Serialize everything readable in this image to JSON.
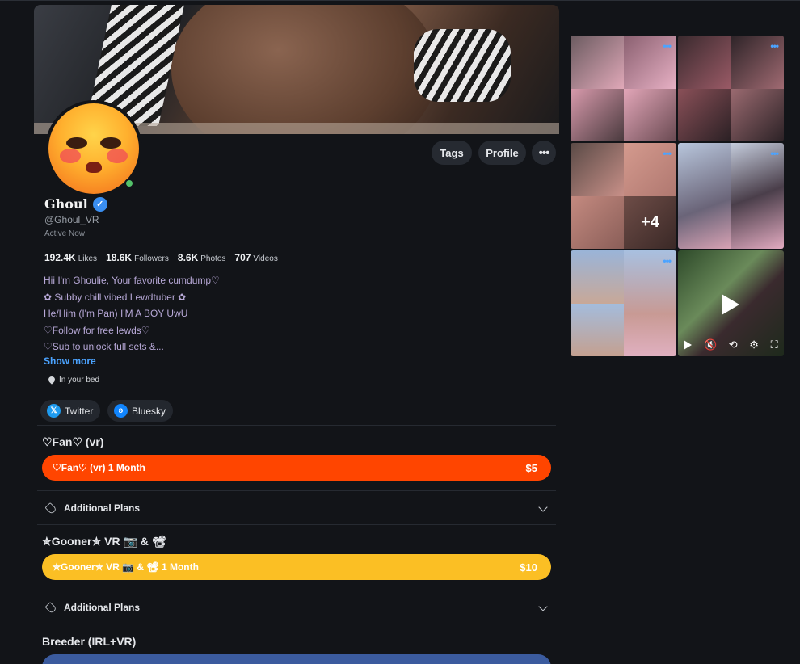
{
  "header": {
    "tags_label": "Tags",
    "profile_label": "Profile",
    "more_label": "•••"
  },
  "profile": {
    "name": "Ghoul",
    "handle": "@Ghoul_VR",
    "status": "Active Now",
    "stats": [
      {
        "value": "192.4K",
        "label": "Likes"
      },
      {
        "value": "18.6K",
        "label": "Followers"
      },
      {
        "value": "8.6K",
        "label": "Photos"
      },
      {
        "value": "707",
        "label": "Videos"
      }
    ],
    "bio": [
      "Hii I'm Ghoulie, Your favorite cumdump♡",
      "✿ Subby chill vibed Lewdtuber ✿",
      "He/Him (I'm Pan) I'M A BOY UwU",
      "♡Follow for free lewds♡",
      "♡Sub to unlock full sets &..."
    ],
    "show_more": "Show more",
    "location": "In your bed",
    "socials": [
      {
        "name": "Twitter",
        "icon": "x-icon"
      },
      {
        "name": "Bluesky",
        "icon": "butterfly-icon"
      }
    ]
  },
  "tiers": [
    {
      "title": "♡Fan♡ (vr)",
      "plan_label": "♡Fan♡ (vr) 1 Month",
      "price": "$5",
      "color": "#ff4500",
      "additional": "Additional Plans"
    },
    {
      "title": "✮Gooner✮ VR 📷 & 📽",
      "plan_label": "✮Gooner✮ VR 📷 & 📽 1 Month",
      "price": "$10",
      "color": "#fbbf24",
      "additional": "Additional Plans"
    },
    {
      "title": "Breeder (IRL+VR)",
      "color": "#3b5b9e"
    }
  ],
  "gallery": {
    "more_count": "+4",
    "more_label": "•••"
  }
}
